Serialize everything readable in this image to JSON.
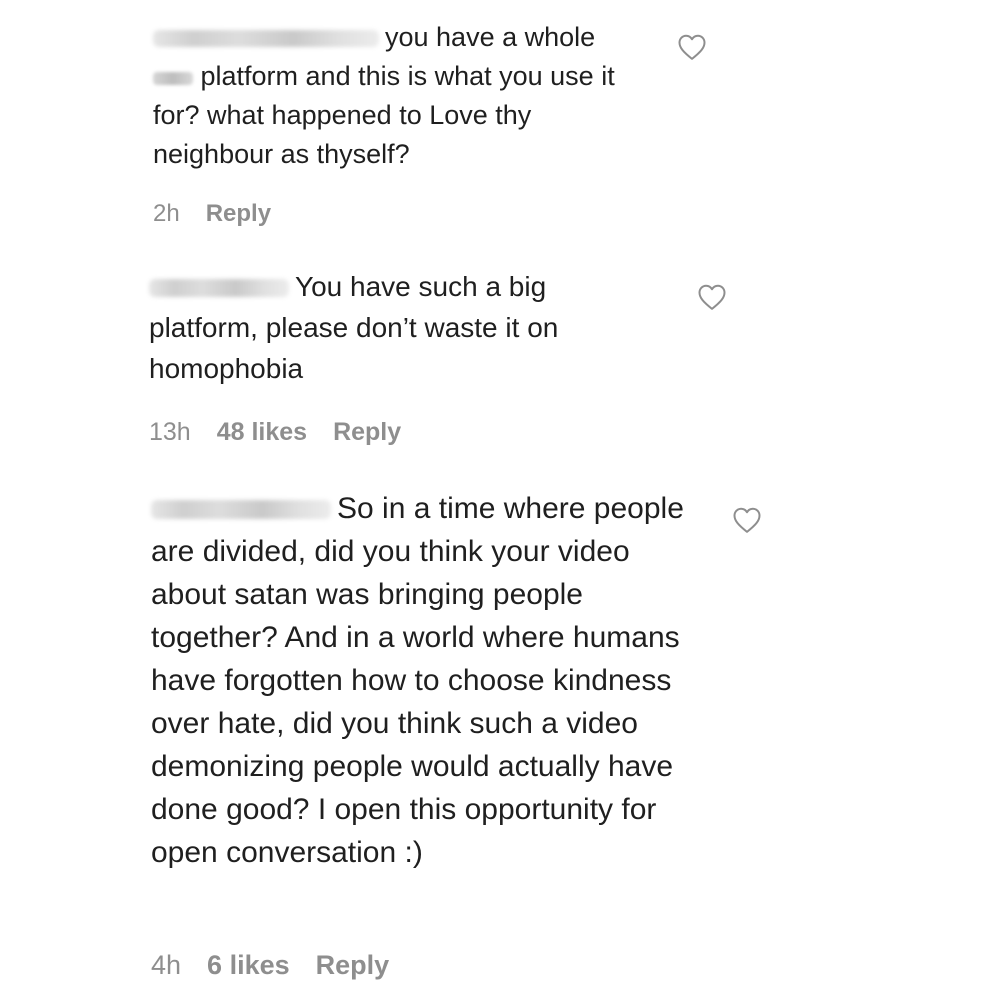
{
  "comments": [
    {
      "username": "",
      "text_before_censor": "you have a whole",
      "text_after_censor": " platform and this is what you use it for? what happened to Love thy neighbour as thyself?",
      "time": "2h",
      "reply_label": "Reply",
      "like_icon": "heart-outline-icon"
    },
    {
      "username": "",
      "text": "You have such a big platform, please don’t waste it on homophobia",
      "time": "13h",
      "likes": "48 likes",
      "reply_label": "Reply",
      "like_icon": "heart-outline-icon"
    },
    {
      "username": "",
      "text": "So in a time where people are divided, did you think your video about satan was bringing people together? And in a world where humans have forgotten how to choose kindness over hate, did you think such a video demonizing people would actually have done good? I open this opportunity for open conversation :)",
      "time": "4h",
      "likes": "6 likes",
      "reply_label": "Reply",
      "like_icon": "heart-outline-icon"
    }
  ],
  "colors": {
    "text": "#1f1f1f",
    "meta": "#8e8e8e",
    "heart_stroke": "#8e8e8e"
  }
}
